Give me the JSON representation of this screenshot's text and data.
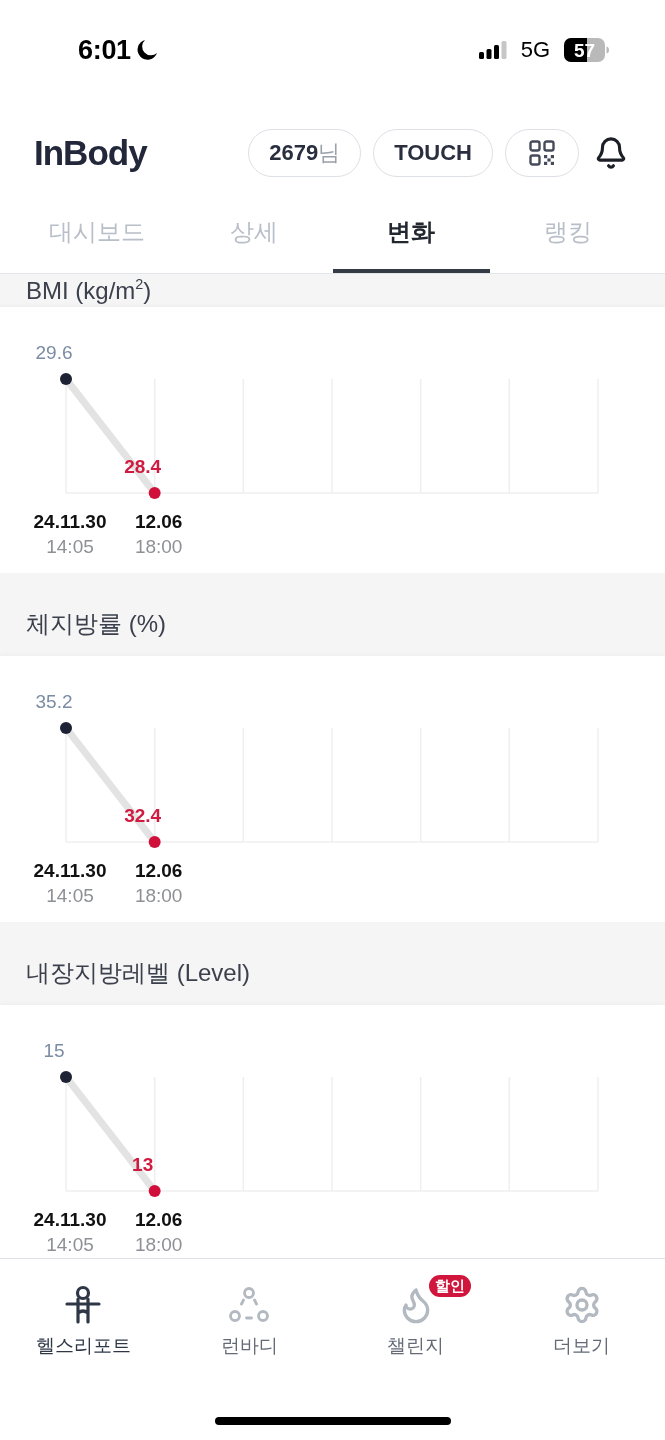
{
  "status_bar": {
    "time": "6:01",
    "network": "5G",
    "battery": "57"
  },
  "header": {
    "logo": "InBody",
    "user_badge": "**2679**님",
    "touch_button": "TOUCH"
  },
  "tabs": [
    {
      "label": "대시보드",
      "selected": false
    },
    {
      "label": "상세",
      "selected": false
    },
    {
      "label": "변화",
      "selected": true
    },
    {
      "label": "랭킹",
      "selected": false
    }
  ],
  "sections": [
    {
      "title": "BMI (kg/m$^{2}$)",
      "times": [
        "14:05",
        "18:00"
      ],
      "chart_data": {
        "type": "line",
        "categories": [
          "24.11.30",
          "12.06"
        ],
        "series": [
          {
            "color": "#e3e3e3",
            "marker": "circle",
            "values": [
              29.6,
              28.4
            ]
          }
        ],
        "data_labels": true
      }
    },
    {
      "title": "체지방률 (%)",
      "times": [
        "14:05",
        "18:00"
      ],
      "chart_data": {
        "type": "line",
        "categories": [
          "24.11.30",
          "12.06"
        ],
        "series": [
          {
            "color": "#e3e3e3",
            "marker": "circle",
            "values": [
              35.2,
              32.4
            ]
          }
        ],
        "data_labels": true
      }
    },
    {
      "title": "내장지방레벨 (Level)",
      "times": [
        "14:05",
        "18:00"
      ],
      "chart_data": {
        "type": "line",
        "categories": [
          "24.11.30",
          "12.06"
        ],
        "series": [
          {
            "color": "#e3e3e3",
            "marker": "circle",
            "values": [
              15,
              13
            ]
          }
        ],
        "data_labels": true
      }
    }
  ],
  "bottom_nav": [
    {
      "label": "헬스리포트",
      "selected": true
    },
    {
      "label": "런바디",
      "selected": false
    },
    {
      "label": "챌린지",
      "selected": false,
      "badge": "할인"
    },
    {
      "label": "더보기",
      "selected": false
    }
  ]
}
